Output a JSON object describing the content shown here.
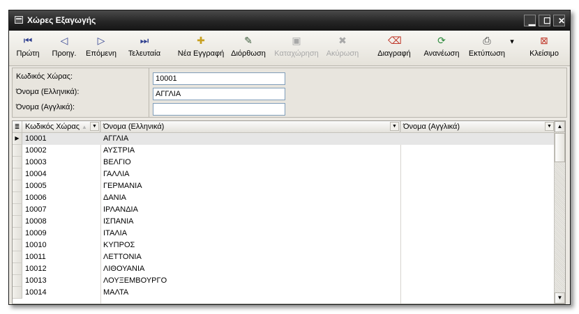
{
  "window": {
    "title": "Χώρες Εξαγωγής",
    "controls": {
      "minimize": "▁",
      "maximize": "☐",
      "close": "✕"
    }
  },
  "toolbar": {
    "buttons": [
      {
        "label": "Πρώτη",
        "icon": "first-record-icon",
        "glyph": "⏮",
        "color": "#2f3f8f"
      },
      {
        "label": "Προηγ.",
        "icon": "previous-record-icon",
        "glyph": "◁",
        "color": "#2f3f8f"
      },
      {
        "label": "Επόμενη",
        "icon": "next-record-icon",
        "glyph": "▷",
        "color": "#2f3f8f"
      },
      {
        "label": "Τελευταία",
        "icon": "last-record-icon",
        "glyph": "⏭",
        "color": "#2f3f8f"
      },
      {
        "label": "Νέα Εγγραφή",
        "icon": "new-record-icon",
        "glyph": "✚",
        "color": "#c8a020"
      },
      {
        "label": "Διόρθωση",
        "icon": "edit-icon",
        "glyph": "✎",
        "color": "#3a5a3a"
      },
      {
        "label": "Καταχώρηση",
        "icon": "save-icon",
        "glyph": "▣",
        "color": "#a8a8a8"
      },
      {
        "label": "Ακύρωση",
        "icon": "cancel-icon",
        "glyph": "✖",
        "color": "#a8a8a8"
      },
      {
        "label": "Διαγραφή",
        "icon": "delete-eraser-icon",
        "glyph": "⌫",
        "color": "#c0392b"
      },
      {
        "label": "Ανανέωση",
        "icon": "refresh-icon",
        "glyph": "⟳",
        "color": "#2e8b3d"
      },
      {
        "label": "Εκτύπωση",
        "icon": "printer-icon",
        "glyph": "⎙",
        "color": "#333333"
      },
      {
        "label": "▾",
        "icon": "print-options-dropdown-icon",
        "glyph": "",
        "color": "#333333"
      },
      {
        "label": "Κλείσιμο",
        "icon": "close-form-icon",
        "glyph": "⊠",
        "color": "#c0392b"
      }
    ]
  },
  "form": {
    "code": {
      "label": "Κωδικός Χώρας:",
      "value": "10001"
    },
    "name_el": {
      "label": "Όνομα (Ελληνικά):",
      "value": "ΑΓΓΛΙΑ"
    },
    "name_en": {
      "label": "Όνομα (Αγγλικά):",
      "value": ""
    }
  },
  "grid": {
    "headers": {
      "code": "Κωδικός Χώρας",
      "name_el": "Όνομα (Ελληνικά)",
      "name_en": "Όνομα (Αγγλικά)"
    },
    "selected_marker": "▶",
    "rows": [
      {
        "code": "10001",
        "name_el": "ΑΓΓΛΙΑ",
        "name_en": ""
      },
      {
        "code": "10002",
        "name_el": "ΑΥΣΤΡΙΑ",
        "name_en": ""
      },
      {
        "code": "10003",
        "name_el": "ΒΕΛΓΙΟ",
        "name_en": ""
      },
      {
        "code": "10004",
        "name_el": "ΓΑΛΛΙΑ",
        "name_en": ""
      },
      {
        "code": "10005",
        "name_el": "ΓΕΡΜΑΝΙΑ",
        "name_en": ""
      },
      {
        "code": "10006",
        "name_el": "ΔΑΝΙΑ",
        "name_en": ""
      },
      {
        "code": "10007",
        "name_el": "ΙΡΛΑΝΔΙΑ",
        "name_en": ""
      },
      {
        "code": "10008",
        "name_el": "ΙΣΠΑΝΙΑ",
        "name_en": ""
      },
      {
        "code": "10009",
        "name_el": "ΙΤΑΛΙΑ",
        "name_en": ""
      },
      {
        "code": "10010",
        "name_el": "ΚΥΠΡΟΣ",
        "name_en": ""
      },
      {
        "code": "10011",
        "name_el": "ΛΕΤΤΟΝΙΑ",
        "name_en": ""
      },
      {
        "code": "10012",
        "name_el": "ΛΙΘΟΥΑΝΙΑ",
        "name_en": ""
      },
      {
        "code": "10013",
        "name_el": "ΛΟΥΞΕΜΒΟΥΡΓΟ",
        "name_en": ""
      },
      {
        "code": "10014",
        "name_el": "ΜΑΛΤΑ",
        "name_en": ""
      }
    ]
  }
}
